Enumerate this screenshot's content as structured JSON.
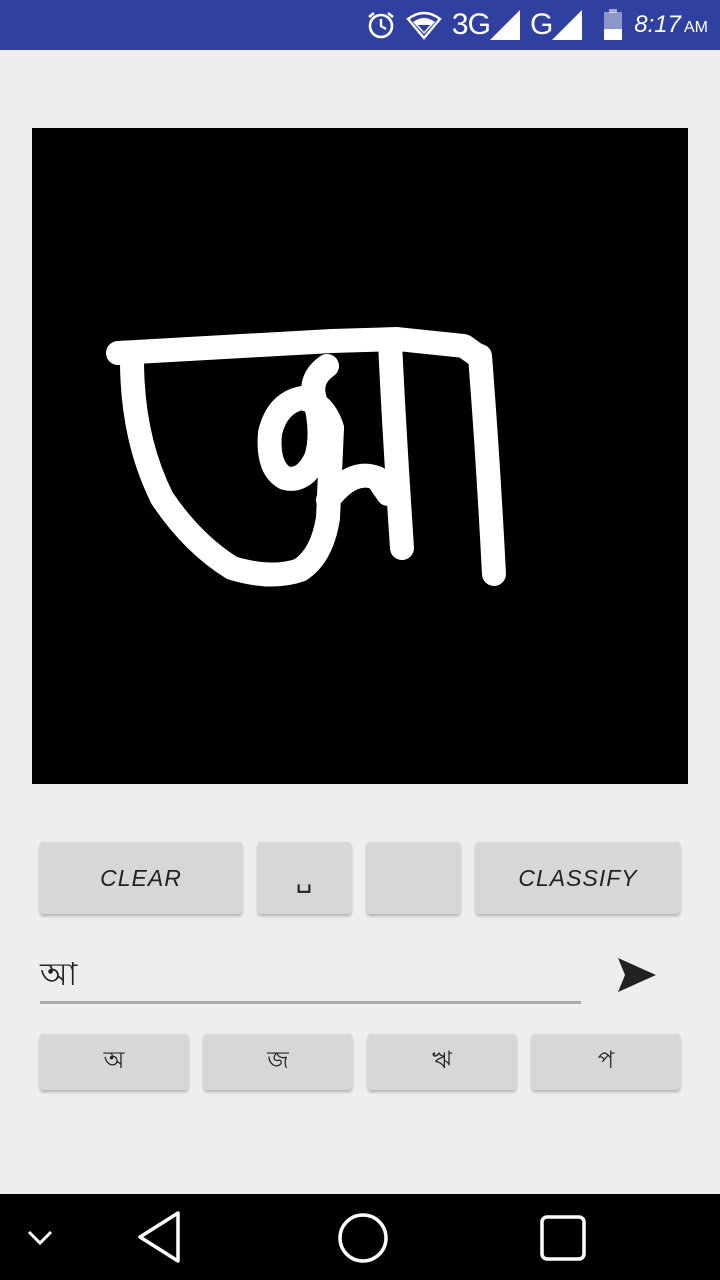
{
  "status_bar": {
    "background": "#3040a0",
    "icons": [
      "alarm-icon",
      "wifi-icon",
      "signal-icon",
      "signal-icon",
      "battery-icon"
    ],
    "network_1": "3G",
    "network_2": "G",
    "time": "8:17",
    "ampm": "AM"
  },
  "canvas": {
    "background": "#000000",
    "stroke_color": "#ffffff",
    "drawn_character": "আ"
  },
  "buttons": {
    "clear": "CLEAR",
    "space": "␣",
    "empty": "",
    "classify": "CLASSIFY"
  },
  "input": {
    "value": "আ",
    "send_icon": "send-icon"
  },
  "suggestions": [
    "অ",
    "জ",
    "ঋ",
    "প"
  ],
  "nav_bar": {
    "icons": [
      "chevron-down-icon",
      "back-icon",
      "home-icon",
      "recents-icon"
    ]
  }
}
